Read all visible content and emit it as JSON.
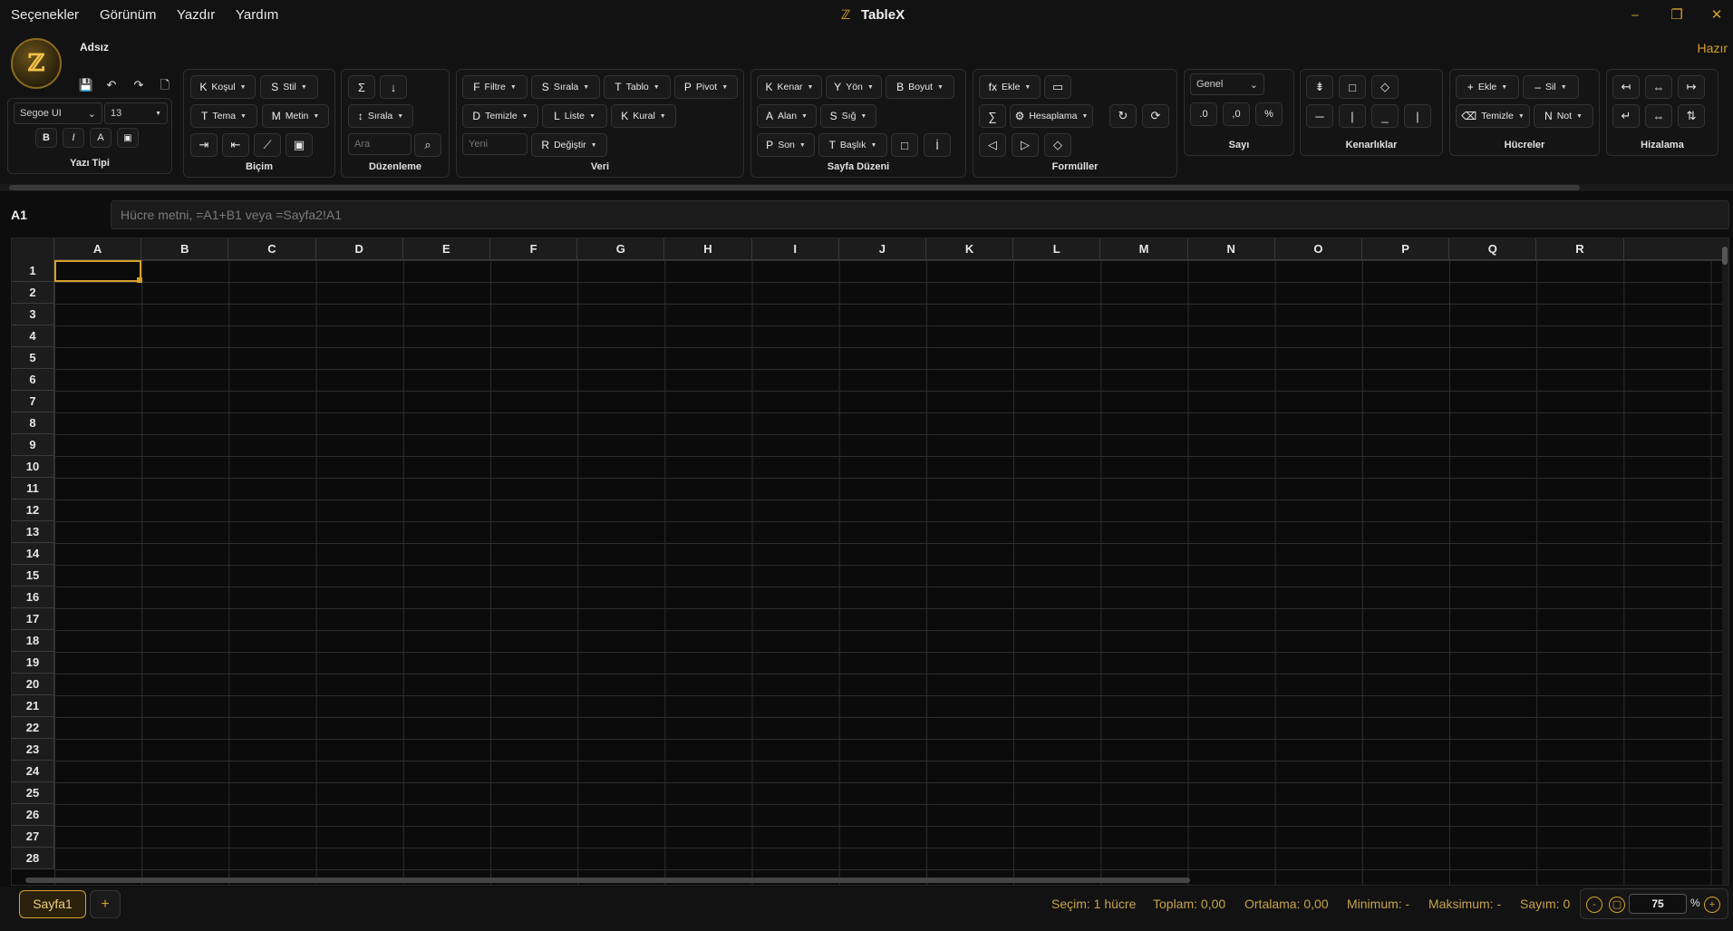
{
  "menubar": {
    "items": [
      "Seçenekler",
      "Görünüm",
      "Yazdır",
      "Yardım"
    ],
    "title": "TableX"
  },
  "window_controls": {
    "minimize": "⎯",
    "maximize": "❐",
    "close": "✕"
  },
  "document": {
    "name": "Adsız",
    "status": "Hazır",
    "logo_glyph": "ℤ"
  },
  "quick_access": [
    "save-icon",
    "undo-icon",
    "redo-icon",
    "new-file-icon"
  ],
  "font_group": {
    "label": "Yazı Tipi",
    "font_name": "Segoe UI",
    "font_size": "13",
    "buttons": [
      "B",
      "I",
      "A",
      "▣"
    ]
  },
  "format_group": {
    "label": "Biçim",
    "row1": [
      {
        "key": "K",
        "text": "Koşul"
      },
      {
        "key": "S",
        "text": "Stil"
      }
    ],
    "row2": [
      {
        "key": "T",
        "text": "Tema"
      },
      {
        "key": "M",
        "text": "Metin"
      }
    ],
    "row3": [
      "⇥",
      "⇤",
      "⟋",
      "▣"
    ]
  },
  "edit_group": {
    "label": "Düzenleme",
    "row1": [
      "Σ",
      "↓"
    ],
    "sort": {
      "key": "↕",
      "text": "Sırala"
    },
    "search_placeholder": "Ara",
    "search_btn": "⌕"
  },
  "data_group": {
    "label": "Veri",
    "row1": [
      {
        "key": "F",
        "text": "Filtre"
      },
      {
        "key": "S",
        "text": "Sırala"
      },
      {
        "key": "T",
        "text": "Tablo"
      },
      {
        "key": "P",
        "text": "Pivot"
      }
    ],
    "row2": [
      {
        "key": "D",
        "text": "Temizle"
      },
      {
        "key": "L",
        "text": "Liste"
      },
      {
        "key": "K",
        "text": "Kural"
      }
    ],
    "new_placeholder": "Yeni",
    "replace": {
      "key": "R",
      "text": "Değiştir"
    }
  },
  "layout_group": {
    "label": "Sayfa Düzeni",
    "row1": [
      {
        "key": "K",
        "text": "Kenar"
      },
      {
        "key": "Y",
        "text": "Yön"
      },
      {
        "key": "B",
        "text": "Boyut"
      }
    ],
    "row2": [
      {
        "key": "A",
        "text": "Alan"
      },
      {
        "key": "S",
        "text": "Sığ"
      }
    ],
    "row3": [
      {
        "key": "P",
        "text": "Son"
      },
      {
        "key": "T",
        "text": "Başlık"
      }
    ],
    "row3_icons": [
      "□",
      "İ"
    ]
  },
  "formula_group": {
    "label": "Formüller",
    "insert": {
      "key": "fx",
      "text": "Ekle"
    },
    "insert_icon": "▭",
    "sum": "∑",
    "calc": {
      "key": "⚙",
      "text": "Hesaplama"
    },
    "calc_icons": [
      "↻",
      "⟳"
    ],
    "row3": [
      "◁",
      "▷",
      "◇"
    ]
  },
  "number_group": {
    "label": "Sayı",
    "format": "Genel",
    "buttons": [
      ".0",
      ",0",
      "%"
    ]
  },
  "border_group": {
    "label": "Kenarlıklar",
    "row1": [
      "⇟",
      "□",
      "◇"
    ],
    "row2": [
      "─",
      "|",
      "_",
      "|"
    ]
  },
  "cells_group": {
    "label": "Hücreler",
    "row1": [
      {
        "key": "+",
        "text": "Ekle"
      },
      {
        "key": "–",
        "text": "Sil"
      }
    ],
    "row2": [
      {
        "key": "⌫",
        "text": "Temizle"
      },
      {
        "key": "N",
        "text": "Not"
      }
    ]
  },
  "align_group": {
    "label": "Hizalama",
    "row1": [
      "↤",
      "⇔",
      "↦"
    ],
    "row2": [
      "↵",
      "⇔",
      "⇅"
    ]
  },
  "formula_bar": {
    "cell_ref": "A1",
    "placeholder": "Hücre metni, =A1+B1 veya =Sayfa2!A1"
  },
  "grid": {
    "columns": [
      "A",
      "B",
      "C",
      "D",
      "E",
      "F",
      "G",
      "H",
      "I",
      "J",
      "K",
      "L",
      "M",
      "N",
      "O",
      "P",
      "Q",
      "R"
    ],
    "rows": [
      "1",
      "2",
      "3",
      "4",
      "5",
      "6",
      "7",
      "8",
      "9",
      "10",
      "11",
      "12",
      "13",
      "14",
      "15",
      "16",
      "17",
      "18",
      "19",
      "20",
      "21",
      "22",
      "23",
      "24",
      "25",
      "26",
      "27",
      "28"
    ],
    "selected_cell": "A1"
  },
  "sheets": {
    "tabs": [
      "Sayfa1"
    ],
    "add": "+"
  },
  "statusbar": {
    "selection": "Seçim: 1 hücre",
    "sum": "Toplam: 0,00",
    "average": "Ortalama: 0,00",
    "min": "Minimum: -",
    "max": "Maksimum: -",
    "count": "Sayım: 0"
  },
  "zoom": {
    "value": "75",
    "unit": "%",
    "minus": "-",
    "fit": "▢",
    "plus": "+"
  },
  "colors": {
    "accent": "#d6a02c",
    "background": "#0d0d0d",
    "panel": "#121212"
  }
}
